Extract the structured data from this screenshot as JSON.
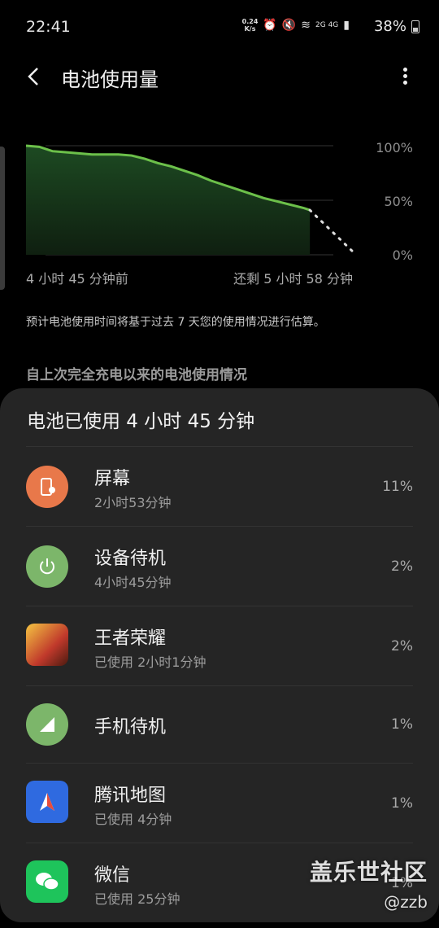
{
  "status_bar": {
    "time": "22:41",
    "speed_value": "0.24",
    "speed_unit": "K/s",
    "network": "2G 4G",
    "battery_pct": "38%"
  },
  "header": {
    "title": "电池使用量"
  },
  "chart": {
    "ytick_100": "100%",
    "ytick_50": "50%",
    "ytick_0": "0%",
    "x_start_label": "4 小时 45 分钟前",
    "x_end_label": "还剩 5 小时 58 分钟"
  },
  "chart_data": {
    "type": "line",
    "ylim": [
      0,
      100
    ],
    "grid": true,
    "series": [
      {
        "x": [
          0,
          4,
          8,
          12,
          16,
          20,
          24,
          28,
          32,
          36,
          40,
          44,
          48,
          52,
          56,
          60,
          64,
          68,
          72,
          76,
          80,
          84,
          86
        ],
        "values": [
          100,
          99,
          95,
          94,
          93,
          92,
          92,
          92,
          91,
          88,
          84,
          81,
          77,
          73,
          68,
          64,
          60,
          56,
          52,
          49,
          46,
          43,
          41
        ]
      },
      {
        "x": [
          86,
          100
        ],
        "values": [
          41,
          0
        ],
        "style": "dotted"
      }
    ]
  },
  "estimate_note": "预计电池使用时间将基于过去 7 天您的使用情况进行估算。",
  "section_title": "自上次完全充电以来的电池使用情况",
  "sheet": {
    "title": "电池已使用 4 小时 45 分钟",
    "apps": [
      {
        "name": "屏幕",
        "sub": "2小时53分钟",
        "pct": "11%",
        "icon": "screen-icon",
        "color": "#e8784a"
      },
      {
        "name": "设备待机",
        "sub": "4小时45分钟",
        "pct": "2%",
        "icon": "power-standby-icon",
        "color": "#7cb66a"
      },
      {
        "name": "王者荣耀",
        "sub": "已使用 2小时1分钟",
        "pct": "2%",
        "icon": "game-icon",
        "color": "#c0392b"
      },
      {
        "name": "手机待机",
        "sub": "",
        "pct": "1%",
        "icon": "signal-icon",
        "color": "#7cb66a"
      },
      {
        "name": "腾讯地图",
        "sub": "已使用 4分钟",
        "pct": "1%",
        "icon": "map-icon",
        "color": "#2f6ae0"
      },
      {
        "name": "微信",
        "sub": "已使用 25分钟",
        "pct": "1%",
        "icon": "chat-icon",
        "color": "#1ec45b"
      }
    ]
  },
  "watermark": {
    "main": "盖乐世社区",
    "sub": "@zzb"
  }
}
